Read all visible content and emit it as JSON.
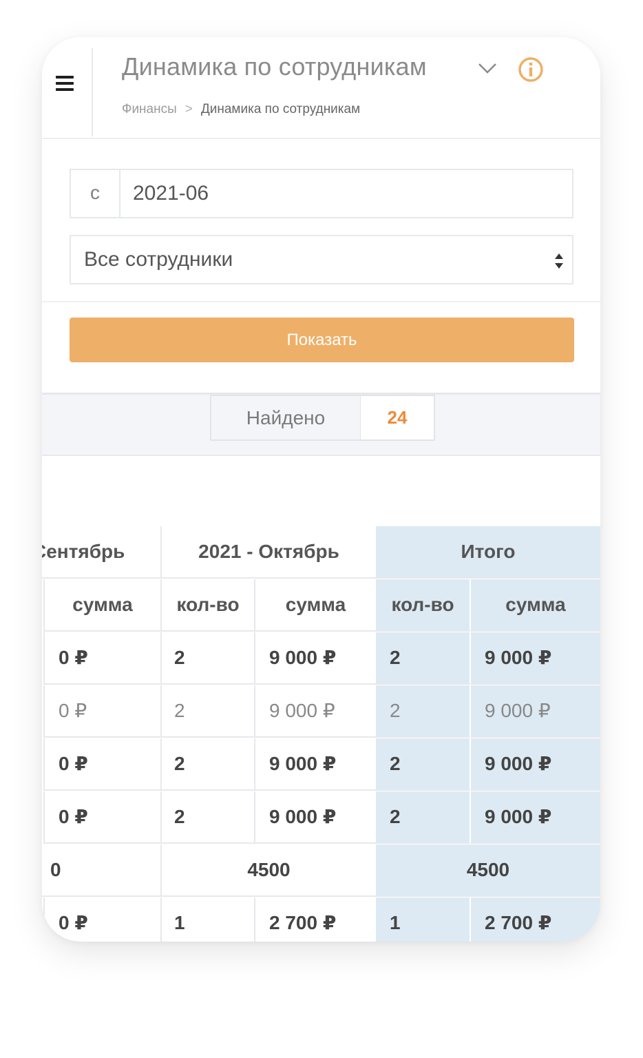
{
  "header": {
    "title": "Динамика по сотрудникам",
    "breadcrumb": {
      "parent": "Финансы",
      "separator": ">",
      "current": "Динамика по сотрудникам"
    }
  },
  "filters": {
    "date_prefix": "с",
    "date_value": "2021-06",
    "employee_select": "Все сотрудники",
    "show_button": "Показать"
  },
  "found": {
    "label": "Найдено",
    "count": "24"
  },
  "colors": {
    "accent": "#eeaf68",
    "count": "#ec8b3a",
    "totals_bg": "#ddeaf3"
  },
  "icons": {
    "menu": "hamburger-icon",
    "dropdown": "chevron-down-icon",
    "info": "info-icon",
    "select": "sort-arrows-icon"
  },
  "table": {
    "group_headers": [
      "Сентябрь",
      "2021 - Октябрь",
      "Итого"
    ],
    "sub_headers": [
      "сумма",
      "кол-во",
      "сумма",
      "кол-во",
      "сумма"
    ],
    "rows": [
      {
        "cells": [
          "0 ₽",
          "2",
          "9 000 ₽",
          "2",
          "9 000 ₽"
        ]
      },
      {
        "cells": [
          "0 ₽",
          "2",
          "9 000 ₽",
          "2",
          "9 000 ₽"
        ]
      },
      {
        "cells": [
          "0 ₽",
          "2",
          "9 000 ₽",
          "2",
          "9 000 ₽"
        ]
      },
      {
        "cells": [
          "0 ₽",
          "2",
          "9 000 ₽",
          "2",
          "9 000 ₽"
        ]
      },
      {
        "cells": [
          "0",
          "4500",
          "4500"
        ]
      },
      {
        "cells": [
          "0 ₽",
          "1",
          "2 700 ₽",
          "1",
          "2 700 ₽"
        ]
      }
    ]
  }
}
